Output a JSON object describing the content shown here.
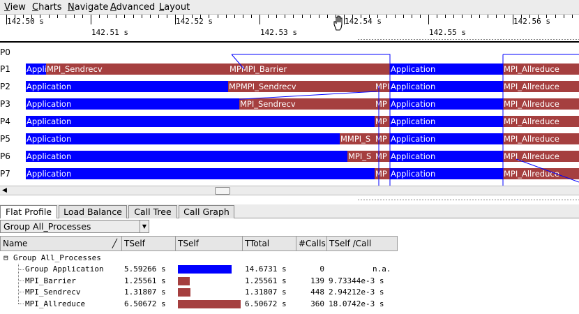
{
  "menu": [
    {
      "label": "View",
      "mnemonic": "V",
      "rest": "iew"
    },
    {
      "label": "Charts",
      "mnemonic": "C",
      "rest": "harts"
    },
    {
      "label": "Navigate",
      "mnemonic": "N",
      "rest": "avigate"
    },
    {
      "label": "Advanced",
      "mnemonic": "A",
      "rest": "dvanced"
    },
    {
      "label": "Layout",
      "mnemonic": "L",
      "rest": "ayout"
    }
  ],
  "ruler": {
    "top_labels": [
      "142.50 s",
      "142.52 s",
      "142.54 s",
      "142.56 s"
    ],
    "bottom_labels": [
      "142.51 s",
      "142.53 s",
      "142.55 s"
    ]
  },
  "processes": [
    "P0",
    "P1",
    "P2",
    "P3",
    "P4",
    "P5",
    "P6",
    "P7"
  ],
  "colors": {
    "application": "#0000ff",
    "mpi": "#a53f3f",
    "message_line": "#0000ff"
  },
  "segment_labels": {
    "P1": [
      "Appli",
      "MPI_Sendrecv",
      "MPMPI_Barrier",
      "Application",
      "MPI_Allreduce"
    ],
    "P2": [
      "Application",
      "MPMPI_Sendrecv",
      "MPI",
      "Application",
      "MPI_Allreduce"
    ],
    "P3": [
      "Application",
      "MPI_Sendrecv",
      "MP",
      "Application",
      "MPI_Allreduce"
    ],
    "P4": [
      "Application",
      "MP",
      "Application",
      "MPI_Allreduce"
    ],
    "P5": [
      "Application",
      "MMPI_S",
      "MP",
      "Application",
      "MPI_Allreduce"
    ],
    "P6": [
      "Application",
      "MPI_S",
      "MP",
      "Application",
      "MPI_Allreduce"
    ],
    "P7": [
      "Application",
      "MP",
      "Application",
      "MPI_Allreduce"
    ]
  },
  "tabs": [
    "Flat Profile",
    "Load Balance",
    "Call Tree",
    "Call Graph"
  ],
  "active_tab": "Flat Profile",
  "group_select": {
    "value": "Group All_Processes"
  },
  "table": {
    "columns": [
      "Name",
      "TSelf",
      "TSelf",
      "TTotal",
      "#Calls",
      "TSelf /Call"
    ],
    "root": {
      "label": "Group All_Processes",
      "expander": "⊟"
    },
    "rows": [
      {
        "name": "Group Application",
        "tself": "5.59266 s",
        "bar_fraction": 0.86,
        "bar_color": "#0000ff",
        "ttotal": "14.6731 s",
        "calls": "0",
        "tself_per_call": "n.a."
      },
      {
        "name": "MPI_Barrier",
        "tself": "1.25561 s",
        "bar_fraction": 0.19,
        "bar_color": "#a53f3f",
        "ttotal": "1.25561 s",
        "calls": "139",
        "tself_per_call": "9.73344e-3 s"
      },
      {
        "name": "MPI_Sendrecv",
        "tself": "1.31807 s",
        "bar_fraction": 0.2,
        "bar_color": "#a53f3f",
        "ttotal": "1.31807 s",
        "calls": "448",
        "tself_per_call": "2.94212e-3 s"
      },
      {
        "name": "MPI_Allreduce",
        "tself": "6.50672 s",
        "bar_fraction": 1.0,
        "bar_color": "#a53f3f",
        "ttotal": "6.50672 s",
        "calls": "360",
        "tself_per_call": "18.0742e-3 s"
      }
    ]
  }
}
